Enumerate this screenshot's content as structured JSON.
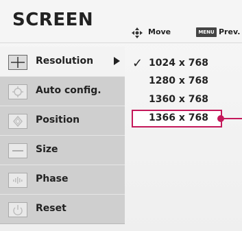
{
  "header": {
    "title": "SCREEN",
    "hints": [
      {
        "icon": "move-icon",
        "label": "Move"
      },
      {
        "key": "MENU",
        "label": "Prev."
      }
    ]
  },
  "menu": {
    "items": [
      {
        "id": "resolution",
        "label": "Resolution",
        "icon": "crosshair-icon",
        "selected": true,
        "has_submenu": true
      },
      {
        "id": "auto-config",
        "label": "Auto config.",
        "icon": "auto-config-icon"
      },
      {
        "id": "position",
        "label": "Position",
        "icon": "position-icon"
      },
      {
        "id": "size",
        "label": "Size",
        "icon": "size-icon"
      },
      {
        "id": "phase",
        "label": "Phase",
        "icon": "phase-icon"
      },
      {
        "id": "reset",
        "label": "Reset",
        "icon": "reset-icon"
      }
    ]
  },
  "resolution_options": {
    "selected_index": 0,
    "highlighted_index": 3,
    "items": [
      "1024 x 768",
      "1280 x 768",
      "1360 x 768",
      "1366 x 768"
    ],
    "check_mark": "✓"
  },
  "colors": {
    "highlight": "#c4185a",
    "panel_bg": "#f2f2f2",
    "menu_bg": "#cfcfcf"
  }
}
